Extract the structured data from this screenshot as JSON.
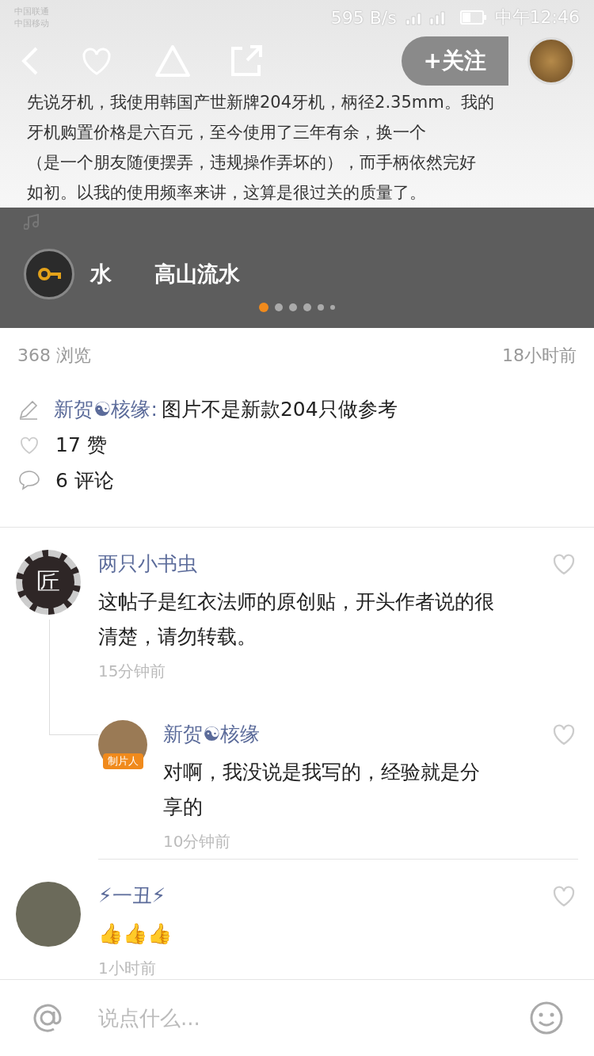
{
  "status_bar": {
    "carriers": [
      "中国联通",
      "中国移动"
    ],
    "speed": "595 B/s",
    "time": "中午12:46"
  },
  "nav": {
    "follow": "+关注"
  },
  "article": {
    "lines": [
      "先说牙机，我使用韩国产世新牌204牙机，柄径2.35mm。我的",
      "牙机购置价格是六百元，至今使用了三年有余，换一个",
      "（是一个朋友随便摆弄，违规操作弄坏的），而手柄依然完好",
      "如初。以我的使用频率来讲，这算是很过关的质量了。"
    ]
  },
  "music": {
    "title_tail": "水",
    "title": "高山流水",
    "dots": [
      {
        "selected": true
      },
      {
        "selected": false
      },
      {
        "selected": false
      },
      {
        "selected": false
      },
      {
        "selected": false
      },
      {
        "selected": false
      }
    ]
  },
  "stats": {
    "views": "368 浏览",
    "time": "18小时前"
  },
  "caption": {
    "author": "新贺☯核缘:",
    "text": "图片不是新款204只做参考"
  },
  "likes": "17 赞",
  "comments_count": "6 评论",
  "comments": [
    {
      "avatar": {
        "kind": "gear",
        "text": "匠"
      },
      "name": "两只小书虫",
      "text": "这帖子是红衣法师的原创贴，开头作者说的很清楚，请勿转载。",
      "time": "15分钟前",
      "replies": [
        {
          "avatar": {
            "kind": "badge",
            "text": "制片人"
          },
          "name": "新贺☯核缘",
          "text": "对啊，我没说是我写的，经验就是分享的",
          "time": "10分钟前"
        }
      ]
    },
    {
      "avatar": {
        "kind": "photo"
      },
      "name": "⚡一丑⚡",
      "text": "👍👍👍",
      "time": "1小时前"
    }
  ],
  "input": {
    "placeholder": "说点什么..."
  }
}
